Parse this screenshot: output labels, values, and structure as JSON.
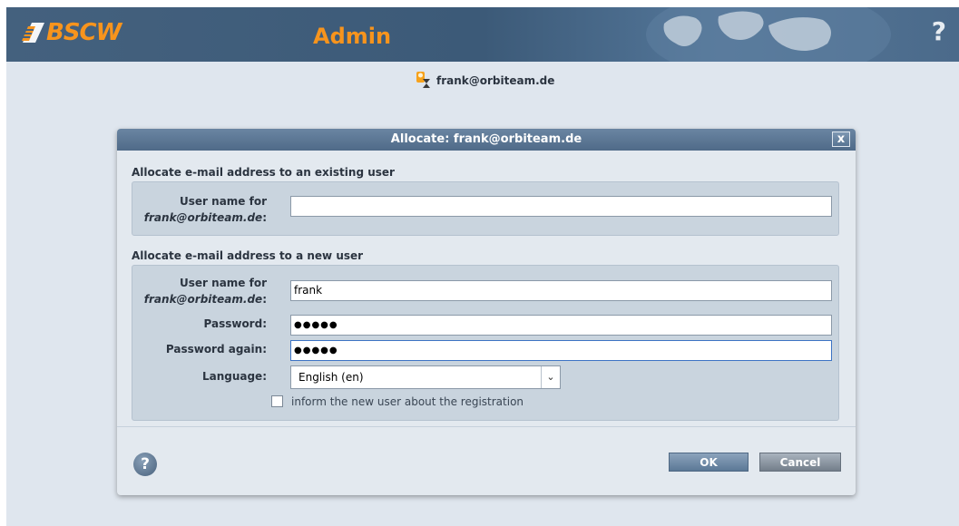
{
  "header": {
    "logo_text": "BSCW",
    "app_title": "Admin",
    "help_label": "?"
  },
  "user_line": {
    "email": "frank@orbiteam.de"
  },
  "dialog": {
    "title": "Allocate: frank@orbiteam.de",
    "close_label": "x",
    "existing": {
      "heading": "Allocate e-mail address to an existing user",
      "label_line1": "User name for",
      "label_email": "frank@orbiteam.de",
      "label_colon": ":",
      "value": ""
    },
    "new_user": {
      "heading": "Allocate e-mail address to a new user",
      "label_line1": "User name for",
      "label_email": "frank@orbiteam.de",
      "label_colon": ":",
      "username_value": "frank",
      "password_label": "Password:",
      "password_value": "●●●●●",
      "password_again_label": "Password again:",
      "password_again_value": "●●●●●",
      "language_label": "Language:",
      "language_value": "English (en)",
      "inform_label": "inform the new user about the registration",
      "inform_checked": false
    },
    "help_label": "?",
    "ok_label": "OK",
    "cancel_label": "Cancel"
  },
  "colors": {
    "header_bg": "#44617e",
    "accent_orange": "#f7941d",
    "page_bg": "#dfe6ee",
    "panel_bg": "#c9d4de"
  }
}
